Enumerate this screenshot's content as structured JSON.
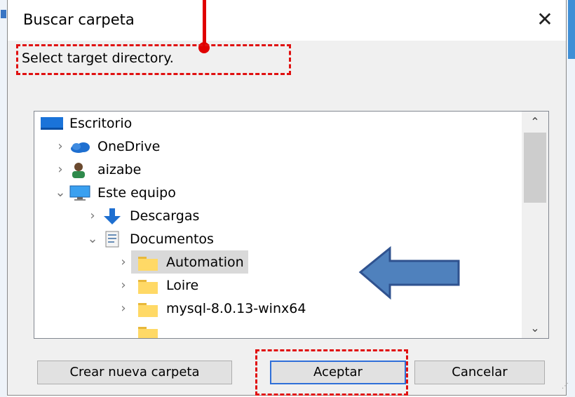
{
  "dialog": {
    "title": "Buscar carpeta",
    "description": "Select target directory."
  },
  "tree": {
    "items": [
      {
        "label": "Escritorio",
        "icon": "desktop-icon",
        "expand": "",
        "level": 0
      },
      {
        "label": "OneDrive",
        "icon": "onedrive-cloud-icon",
        "expand": ">",
        "level": 1
      },
      {
        "label": "aizabe",
        "icon": "user-icon",
        "expand": ">",
        "level": 1
      },
      {
        "label": "Este equipo",
        "icon": "computer-icon",
        "expand": "v",
        "level": 1
      },
      {
        "label": "Descargas",
        "icon": "download-arrow-icon",
        "expand": ">",
        "level": 2
      },
      {
        "label": "Documentos",
        "icon": "documents-icon",
        "expand": "v",
        "level": 2
      },
      {
        "label": "Automation",
        "icon": "folder-icon",
        "expand": ">",
        "level": 3,
        "selected": true
      },
      {
        "label": "Loire",
        "icon": "folder-icon",
        "expand": ">",
        "level": 3
      },
      {
        "label": "mysql-8.0.13-winx64",
        "icon": "folder-icon",
        "expand": ">",
        "level": 3
      }
    ]
  },
  "buttons": {
    "new_folder": "Crear nueva carpeta",
    "accept": "Aceptar",
    "cancel": "Cancelar"
  },
  "colors": {
    "annotation": "#e01010",
    "arrow_fill": "#4f81bd",
    "arrow_stroke": "#2f528f",
    "folder": "#ffd966",
    "accent": "#2f6fd8"
  }
}
